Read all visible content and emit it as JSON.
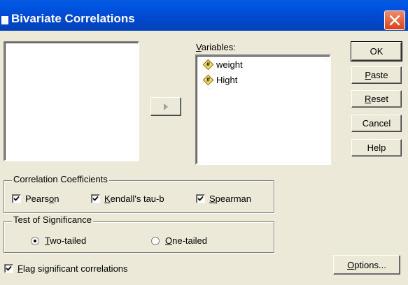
{
  "window": {
    "title": "Bivariate Correlations",
    "close_icon": "close-x-icon",
    "accent": "#0054e3",
    "close_color": "#e04a1f"
  },
  "source_list": {
    "items": []
  },
  "move_button": {
    "icon": "right-arrow-icon"
  },
  "variables": {
    "label": {
      "pre": "",
      "accel": "V",
      "post": "ariables:"
    },
    "items": [
      {
        "name": "weight",
        "icon": "scale-variable-icon"
      },
      {
        "name": "Hight",
        "icon": "scale-variable-icon"
      }
    ]
  },
  "buttons": {
    "ok": {
      "pre": "OK",
      "accel": "",
      "post": ""
    },
    "paste": {
      "pre": "",
      "accel": "P",
      "post": "aste"
    },
    "reset": {
      "pre": "",
      "accel": "R",
      "post": "eset"
    },
    "cancel": {
      "pre": "Cancel",
      "accel": "",
      "post": ""
    },
    "help": {
      "pre": "Help",
      "accel": "",
      "post": ""
    },
    "options": {
      "pre": "",
      "accel": "O",
      "post": "ptions..."
    }
  },
  "correlation": {
    "legend": "Correlation Coefficients",
    "pearson": {
      "pre": "Pears",
      "accel": "o",
      "post": "n",
      "checked": true
    },
    "kendall": {
      "pre": "",
      "accel": "K",
      "post": "endall's tau-b",
      "checked": true
    },
    "spearman": {
      "pre": "",
      "accel": "S",
      "post": "pearman",
      "checked": true
    }
  },
  "significance": {
    "legend": "Test of Significance",
    "two_tailed": {
      "pre": "",
      "accel": "T",
      "post": "wo-tailed",
      "selected": true
    },
    "one_tailed": {
      "pre": "",
      "accel": "O",
      "post": "ne-tailed",
      "selected": false
    }
  },
  "flag": {
    "pre": "",
    "accel": "F",
    "post": "lag significant correlations",
    "checked": true
  }
}
